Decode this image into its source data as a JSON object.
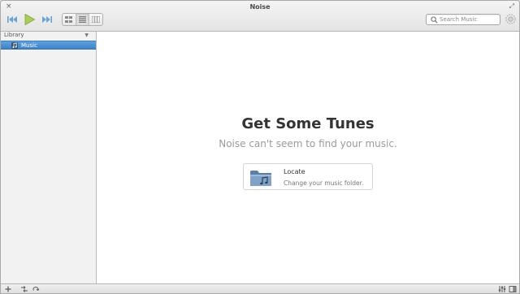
{
  "window": {
    "title": "Noise",
    "close_icon": "×",
    "maximize_icon": "⤢"
  },
  "toolbar": {
    "previous_icon": "skip-back-icon",
    "play_icon": "play-icon",
    "next_icon": "skip-forward-icon",
    "view_modes": [
      "grid-view",
      "list-view",
      "column-view"
    ],
    "active_view": "list-view",
    "search_placeholder": "Search Music",
    "search_value": ""
  },
  "sidebar": {
    "header_label": "Library",
    "header_arrow": "▼",
    "items": [
      {
        "label": "Music",
        "selected": true
      }
    ]
  },
  "welcome": {
    "title": "Get Some Tunes",
    "subtitle": "Noise can't seem to find your music.",
    "action_title": "Locate",
    "action_subtitle": "Change your music folder."
  },
  "bottombar": {
    "left_icons": [
      "add-icon",
      "shuffle-icon",
      "repeat-icon"
    ],
    "right_icons": [
      "equalizer-icon",
      "info-panel-icon"
    ]
  },
  "colors": {
    "selection": "#4a8fd4",
    "play_green": "#9bc53d",
    "transport_blue": "#6aa2d6"
  }
}
